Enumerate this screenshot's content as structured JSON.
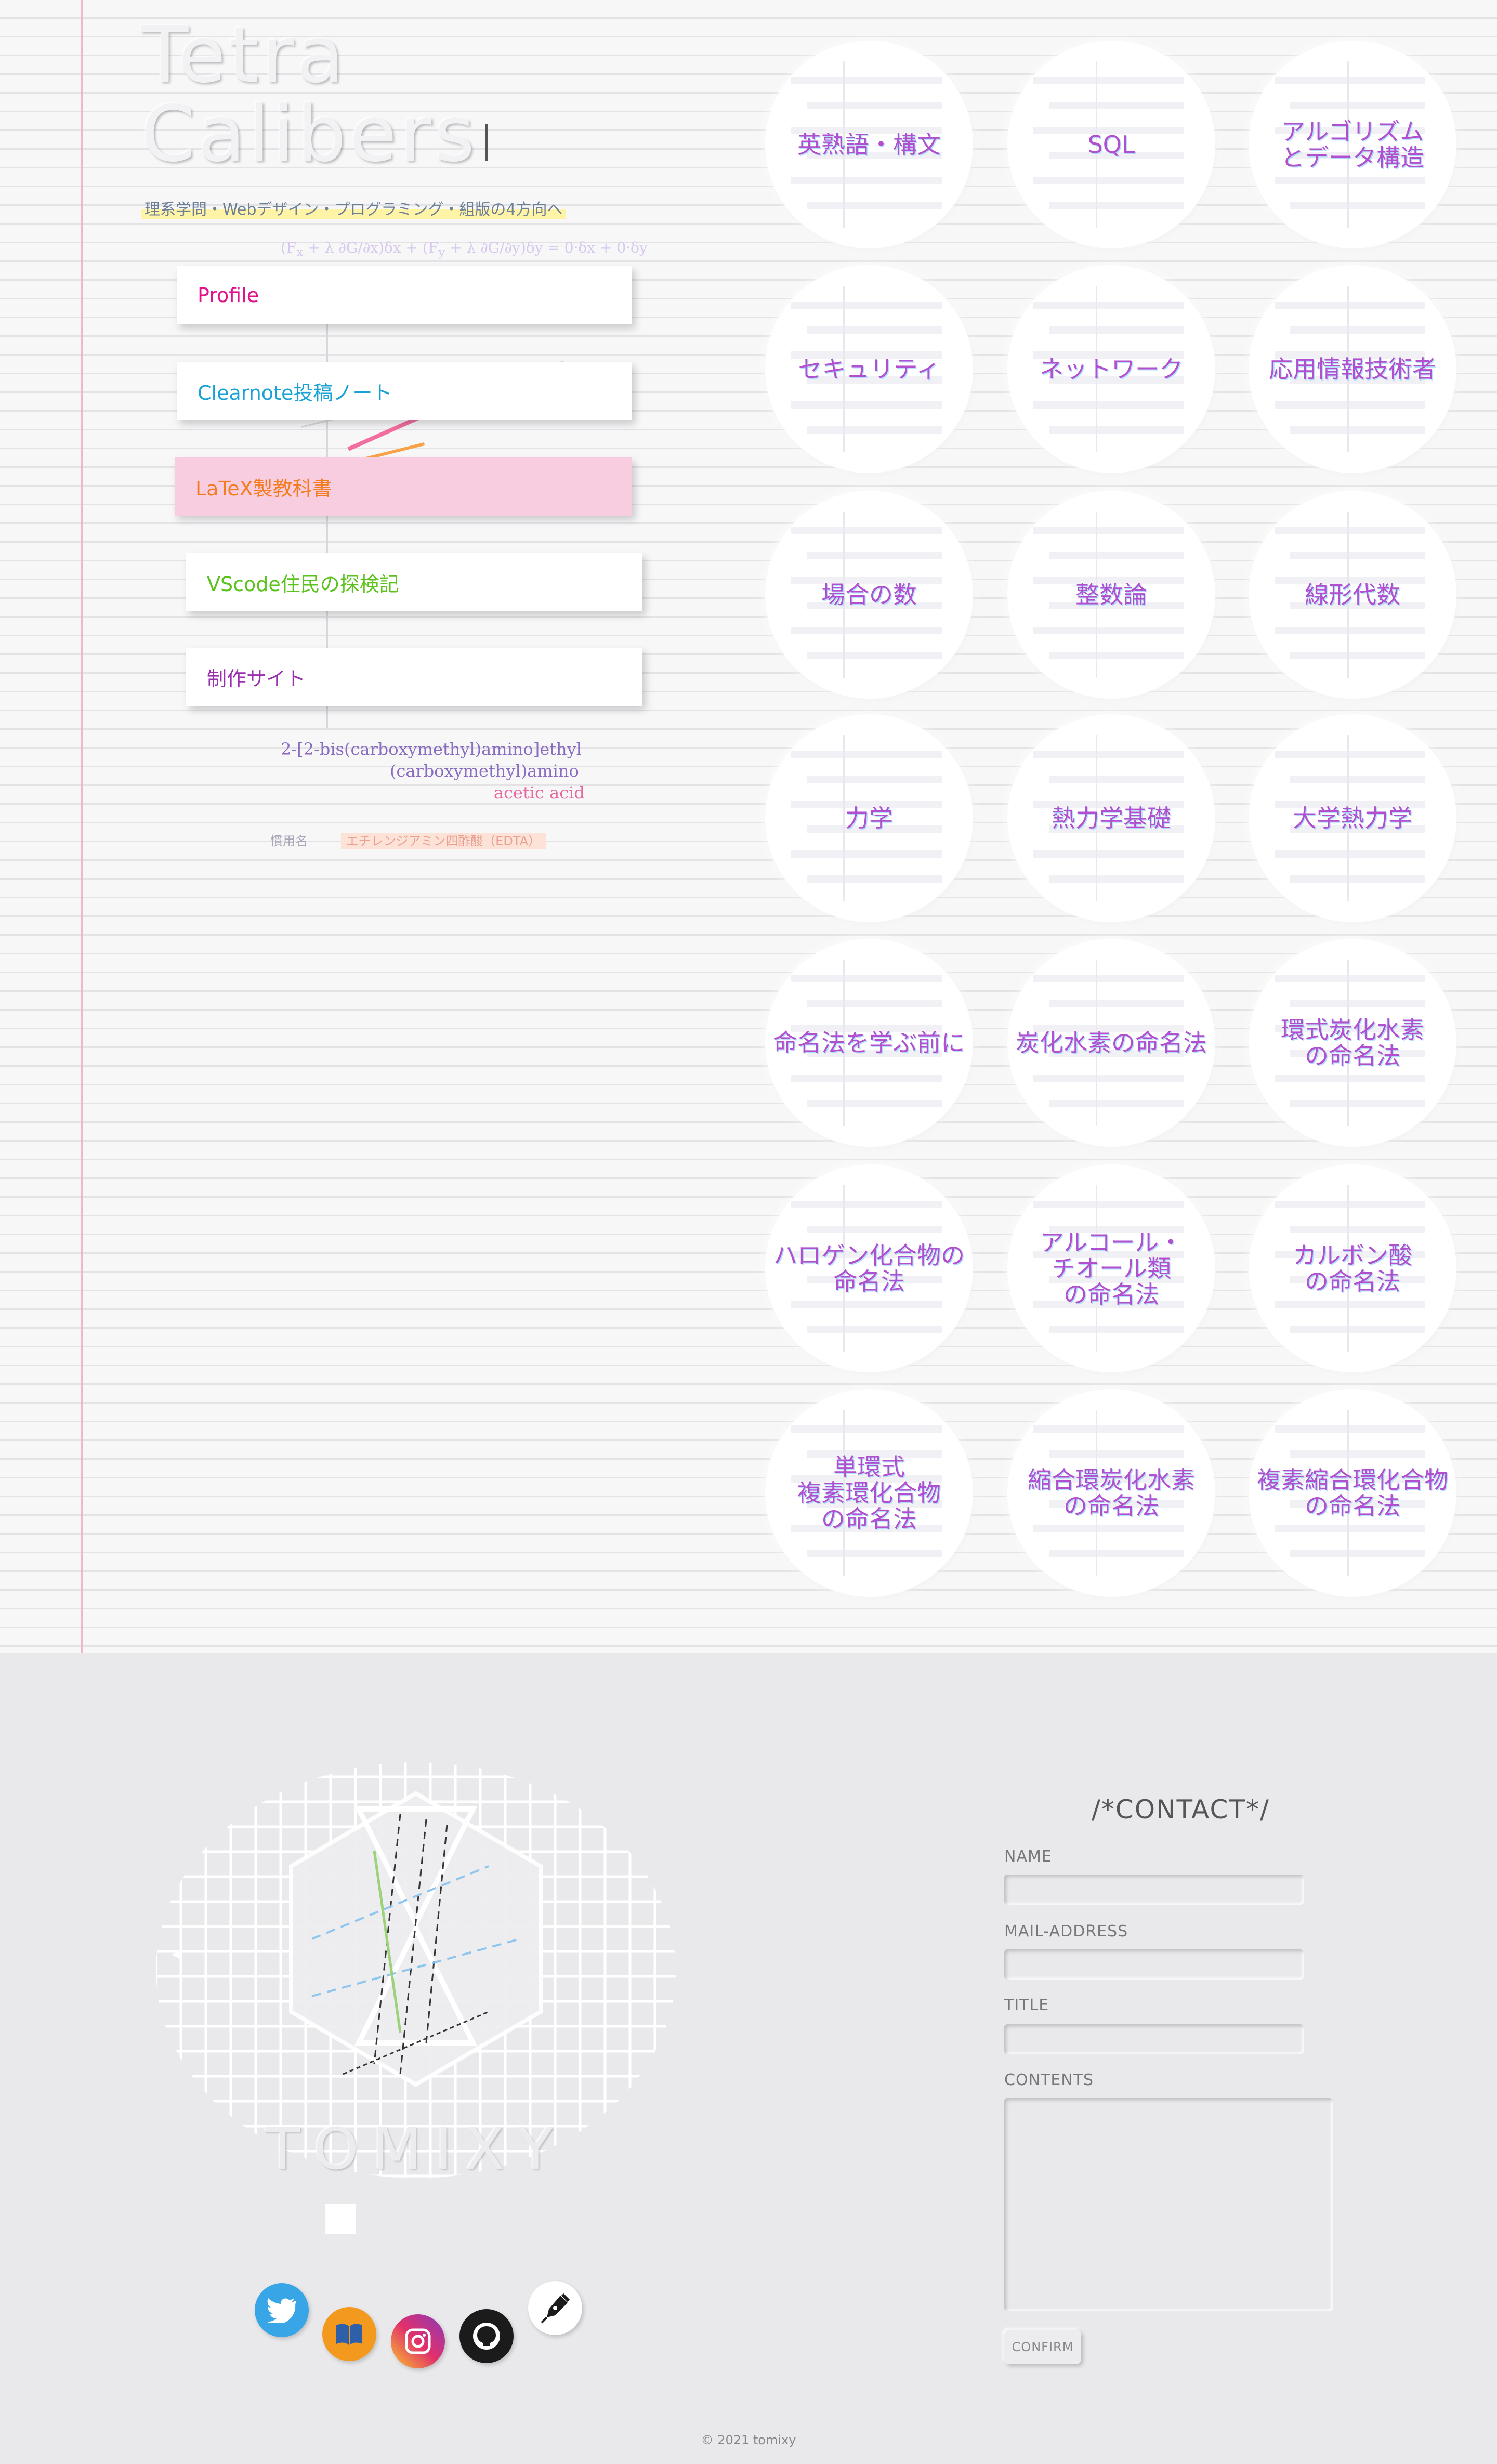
{
  "site": {
    "title_line1": "Tetra",
    "title_line2": "Calibers",
    "tagline": "理系学問・Webデザイン・プログラミング・組版の4方向へ"
  },
  "nav": [
    {
      "label": "Profile",
      "color": "#e0138c"
    },
    {
      "label": "Clearnote投稿ノート",
      "color": "#1aa2d6"
    },
    {
      "label": "LaTeX製教科書",
      "color": "#f47c20"
    },
    {
      "label": "VScode住民の探検記",
      "color": "#5cc21d"
    },
    {
      "label": "制作サイト",
      "color": "#9a2fb0"
    }
  ],
  "background_notes": {
    "compound_name_1": "2-[2-bis(carboxymethyl)amino]ethyl",
    "compound_name_2": "(carboxymethyl)amino",
    "compound_name_3": "acetic acid",
    "common_name_label": "慣用名",
    "common_name_value": "エチレンジアミン四酢酸（EDTA）"
  },
  "topics": [
    {
      "label": "英熟語・構文"
    },
    {
      "label": "SQL"
    },
    {
      "label": "アルゴリズム\nとデータ構造"
    },
    {
      "label": "セキュリティ"
    },
    {
      "label": "ネットワーク"
    },
    {
      "label": "応用情報技術者"
    },
    {
      "label": "場合の数"
    },
    {
      "label": "整数論"
    },
    {
      "label": "線形代数"
    },
    {
      "label": "力学"
    },
    {
      "label": "熱力学基礎"
    },
    {
      "label": "大学熱力学"
    },
    {
      "label": "命名法を学ぶ前に"
    },
    {
      "label": "炭化水素の命名法"
    },
    {
      "label": "環式炭化水素\nの命名法"
    },
    {
      "label": "ハロゲン化合物の\n命名法"
    },
    {
      "label": "アルコール・\nチオール類\nの命名法"
    },
    {
      "label": "カルボン酸\nの命名法"
    },
    {
      "label": "単環式\n複素環化合物\nの命名法"
    },
    {
      "label": "縮合環炭化水素\nの命名法"
    },
    {
      "label": "複素縮合環化合物\nの命名法"
    }
  ],
  "emblem": {
    "name": "TOMIXY"
  },
  "social": [
    {
      "name": "twitter-icon",
      "color": "#3aa8e8"
    },
    {
      "name": "book-icon",
      "color": "#f39a1e"
    },
    {
      "name": "instagram-icon",
      "color": "#d6297c"
    },
    {
      "name": "github-icon",
      "color": "#1b1b1b"
    },
    {
      "name": "pen-icon",
      "color": "#ffffff"
    }
  ],
  "contact": {
    "title": "/*CONTACT*/",
    "name_label": "NAME",
    "mail_label": "MAIL-ADDRESS",
    "title_label": "TITLE",
    "contents_label": "CONTENTS",
    "confirm_label": "CONFIRM"
  },
  "footer": {
    "copyright": "© 2021 tomixy"
  }
}
